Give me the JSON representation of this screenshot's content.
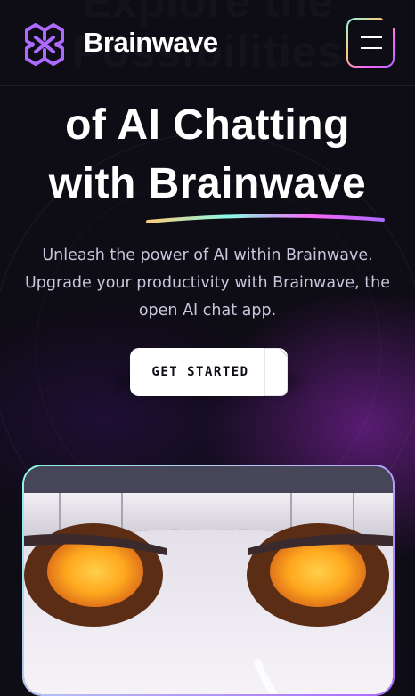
{
  "header": {
    "brand": "Brainwave",
    "logo_icon": "brain-logo-icon",
    "menu_icon": "hamburger-menu-icon"
  },
  "hero": {
    "ghost_heading": "Explore the Possibilities",
    "heading_line1": "of AI Chatting",
    "heading_line2": "with Brainwave",
    "subtitle": "Unleash the power of AI within Brainwave. Upgrade your productivity with Brainwave, the open AI chat app.",
    "cta_label": "GET STARTED"
  },
  "preview": {
    "image_icon": "robot-face-illustration"
  },
  "colors": {
    "background": "#0e0c15",
    "logo_purple": "#ac6aff",
    "gradient": [
      "#89f9e8",
      "#facb7b",
      "#fa66f9",
      "#ac6aff"
    ],
    "cta_bg": "#ffffff",
    "subtitle_text": "#cac6dd"
  }
}
